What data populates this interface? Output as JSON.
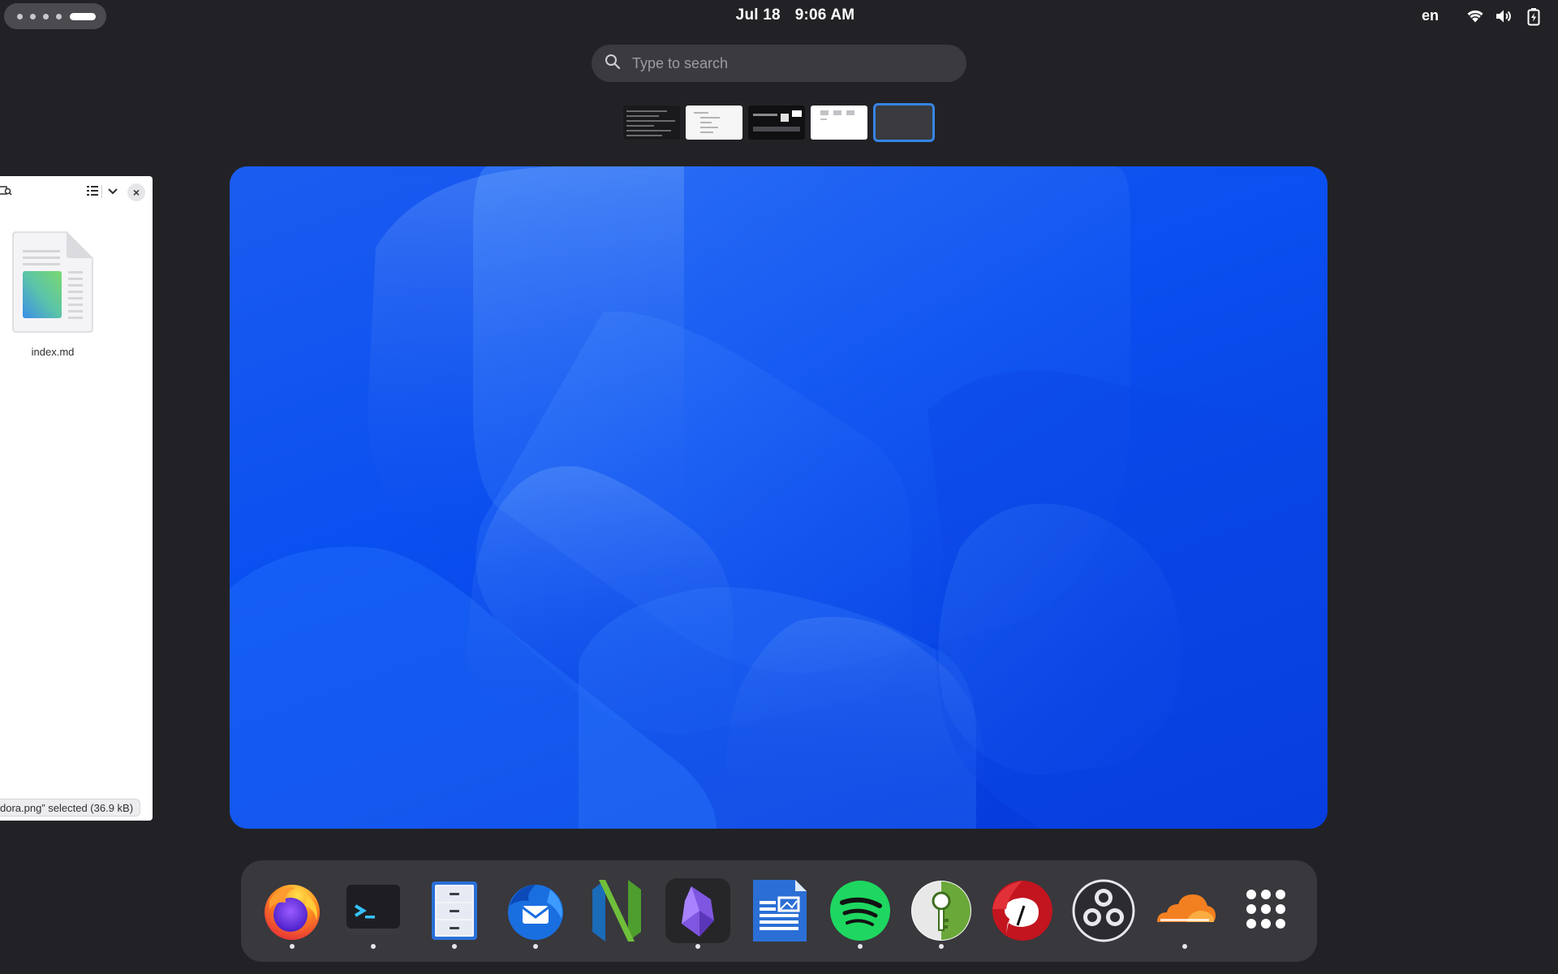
{
  "topbar": {
    "date": "Jul 18",
    "time": "9:06 AM",
    "language": "en",
    "tray_icons": [
      "wifi-icon",
      "volume-icon",
      "battery-charging-icon"
    ]
  },
  "search": {
    "placeholder": "Type to search"
  },
  "workspaces": {
    "count": 5,
    "active_index": 4
  },
  "file_window": {
    "file_name": "index.md",
    "status": "dora.png” selected  (36.9 kB)",
    "icons": [
      "search-location-icon",
      "list-view-icon",
      "chevron-down-icon",
      "close-icon"
    ]
  },
  "dock": {
    "apps": [
      {
        "name": "Firefox",
        "icon": "firefox-icon",
        "running": true
      },
      {
        "name": "Terminal",
        "icon": "terminal-icon",
        "running": true
      },
      {
        "name": "Files",
        "icon": "file-cabinet-icon",
        "running": true
      },
      {
        "name": "Thunderbird",
        "icon": "thunderbird-icon",
        "running": true
      },
      {
        "name": "Neovim",
        "icon": "neovim-icon",
        "running": false
      },
      {
        "name": "Obsidian",
        "icon": "obsidian-icon",
        "running": true
      },
      {
        "name": "Writer",
        "icon": "writer-icon",
        "running": false
      },
      {
        "name": "Spotify",
        "icon": "spotify-icon",
        "running": true
      },
      {
        "name": "KeePassXC",
        "icon": "keepass-icon",
        "running": true
      },
      {
        "name": "Tempomat",
        "icon": "red-chat-icon",
        "running": false
      },
      {
        "name": "OBS Studio",
        "icon": "obs-icon",
        "running": false
      },
      {
        "name": "Cloudflare WARP",
        "icon": "cloudflare-icon",
        "running": true
      },
      {
        "name": "Show Apps",
        "icon": "app-grid-icon",
        "running": false
      }
    ]
  },
  "colors": {
    "panel_bg": "#222226",
    "accent": "#3584e4",
    "wallpaper_blue": "#0a4ff0"
  }
}
